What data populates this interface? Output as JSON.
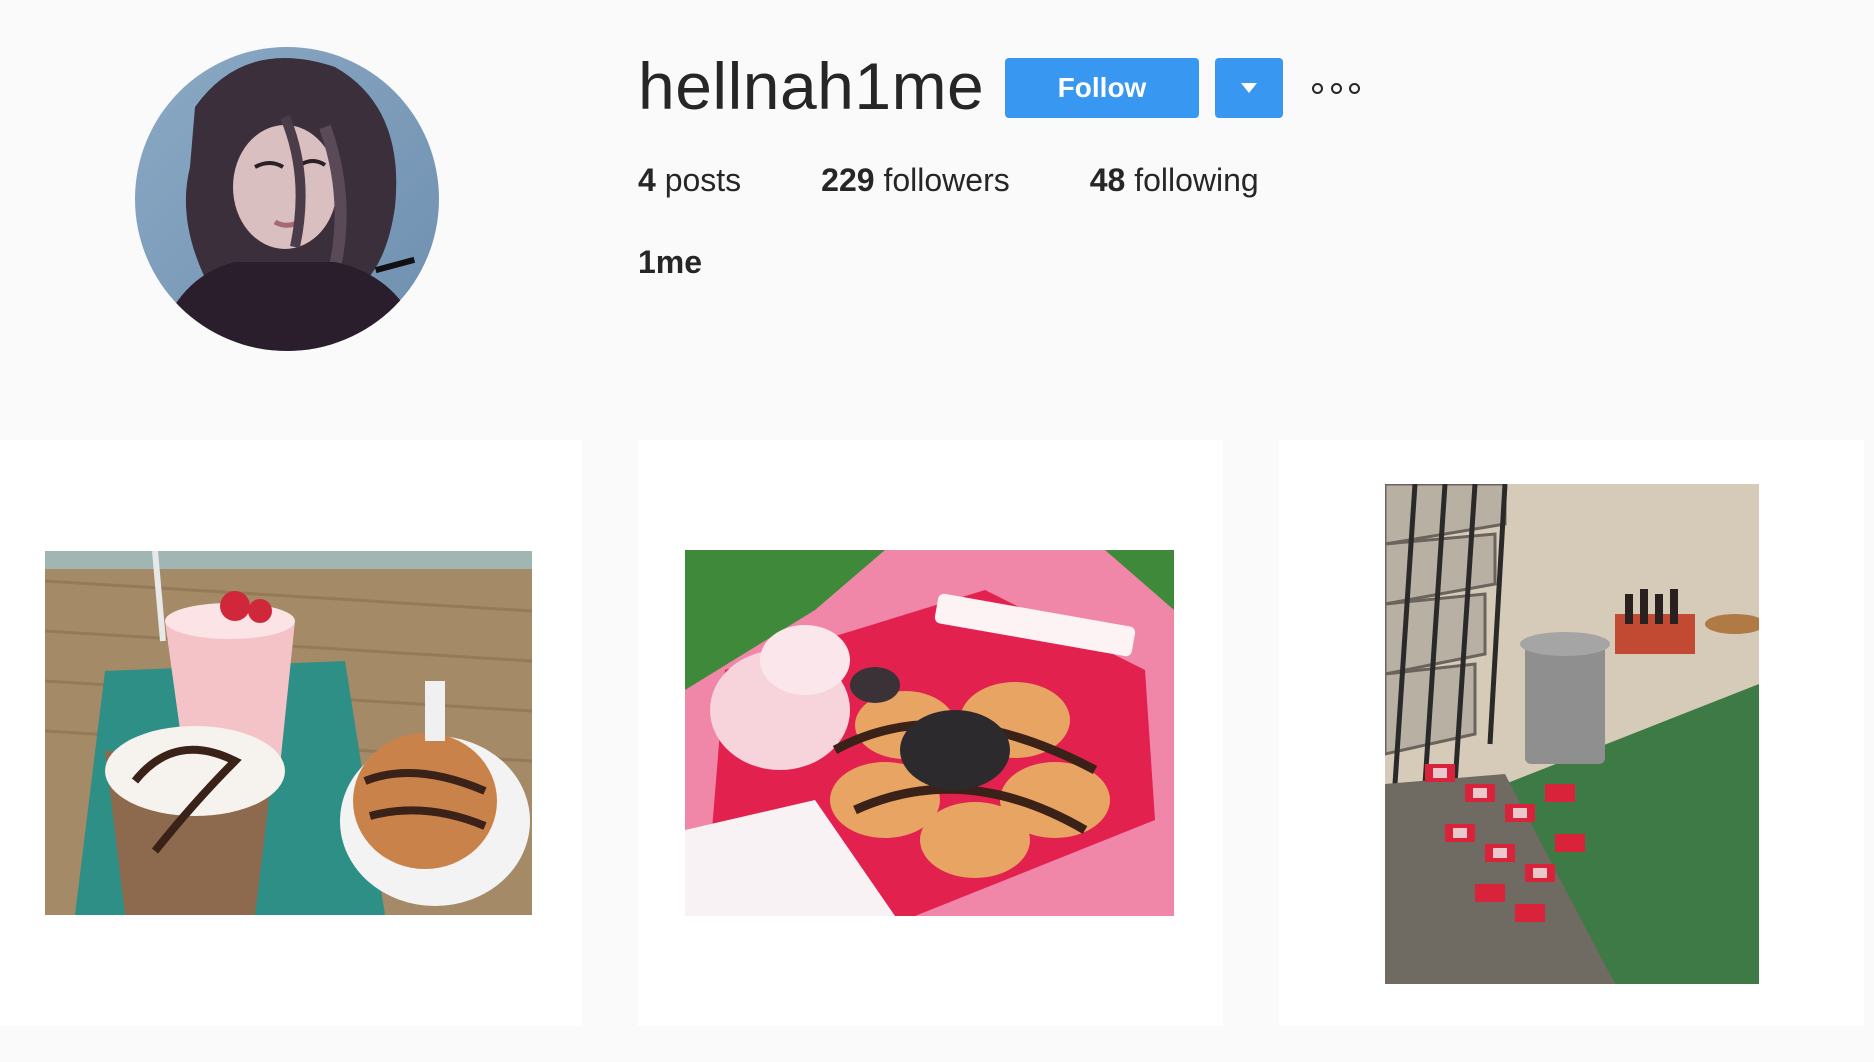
{
  "profile": {
    "username": "hellnah1me",
    "full_name": "1me",
    "avatar_icon": "profile-photo-avatar",
    "follow_label": "Follow",
    "dropdown_icon": "caret-down-icon",
    "more_icon": "more-options-icon"
  },
  "stats": {
    "posts_count": "4",
    "posts_label": "posts",
    "followers_count": "229",
    "followers_label": "followers",
    "following_count": "48",
    "following_label": "following"
  },
  "posts": [
    {
      "subject": "milkshake, iced coffee and muffin"
    },
    {
      "subject": "pancakes with chocolate and cookies"
    },
    {
      "subject": "stairway with trash can and boxes"
    }
  ],
  "colors": {
    "accent": "#3897f0",
    "background": "#fafafa",
    "text": "#262626"
  }
}
